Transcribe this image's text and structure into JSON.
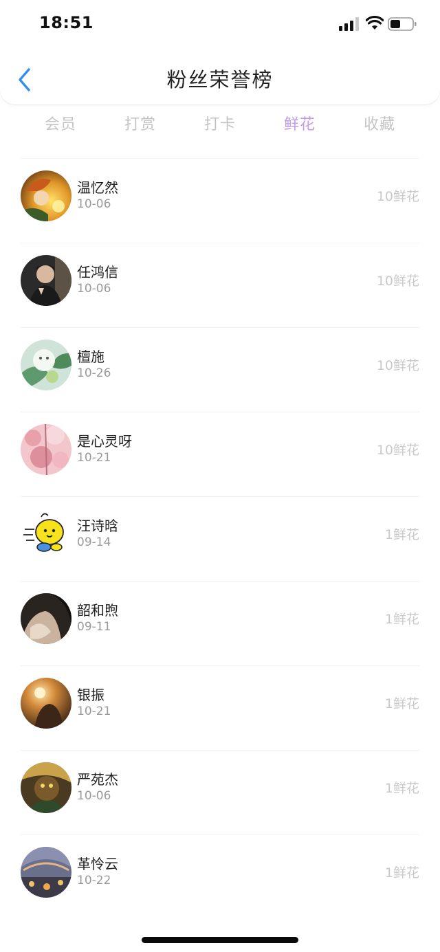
{
  "status_bar": {
    "time": "18:51"
  },
  "nav": {
    "title": "粉丝荣誉榜"
  },
  "tabs": [
    {
      "label": "会员",
      "active": false
    },
    {
      "label": "打赏",
      "active": false
    },
    {
      "label": "打卡",
      "active": false
    },
    {
      "label": "鲜花",
      "active": true
    },
    {
      "label": "收藏",
      "active": false
    }
  ],
  "colors": {
    "accent": "#c39be6",
    "back": "#2f8ff0"
  },
  "fans": [
    {
      "name": "温忆然",
      "date": "10-06",
      "count": "10鲜花",
      "avatar": "avatar-anime-orange"
    },
    {
      "name": "任鸿信",
      "date": "10-06",
      "count": "10鲜花",
      "avatar": "avatar-person-dark"
    },
    {
      "name": "檀施",
      "date": "10-26",
      "count": "10鲜花",
      "avatar": "avatar-plant-green"
    },
    {
      "name": "是心灵呀",
      "date": "10-21",
      "count": "10鲜花",
      "avatar": "avatar-pink-flowers"
    },
    {
      "name": "汪诗晗",
      "date": "09-14",
      "count": "1鲜花",
      "avatar": "avatar-yellow-cartoon"
    },
    {
      "name": "韶和煦",
      "date": "09-11",
      "count": "1鲜花",
      "avatar": "avatar-dark-portrait"
    },
    {
      "name": "银振",
      "date": "10-21",
      "count": "1鲜花",
      "avatar": "avatar-sunset"
    },
    {
      "name": "严苑杰",
      "date": "10-06",
      "count": "1鲜花",
      "avatar": "avatar-game-hero"
    },
    {
      "name": "革怜云",
      "date": "10-22",
      "count": "1鲜花",
      "avatar": "avatar-city-night"
    }
  ]
}
